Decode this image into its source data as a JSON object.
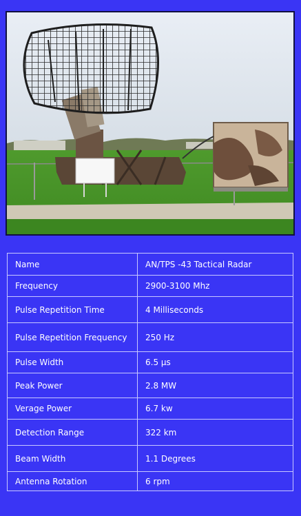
{
  "photo": {
    "icon": "radar-antenna-photo"
  },
  "specs": {
    "rows": [
      {
        "label": "Name",
        "value": "AN/TPS -43 Tactical Radar"
      },
      {
        "label": "Frequency",
        "value": "2900-3100 Mhz"
      },
      {
        "label": "Pulse Repetition  Time",
        "value": "4 Milliseconds"
      },
      {
        "label": "Pulse Repetition  Frequency",
        "value": "250 Hz"
      },
      {
        "label": "Pulse Width",
        "value": "6.5 µs"
      },
      {
        "label": "Peak Power",
        "value": "2.8 MW"
      },
      {
        "label": "Verage Power",
        "value": "6.7 kw"
      },
      {
        "label": "Detection Range",
        "value": "322 km"
      },
      {
        "label": "Beam Width",
        "value": "1.1 Degrees"
      },
      {
        "label": "Antenna Rotation",
        "value": "6 rpm"
      }
    ]
  }
}
